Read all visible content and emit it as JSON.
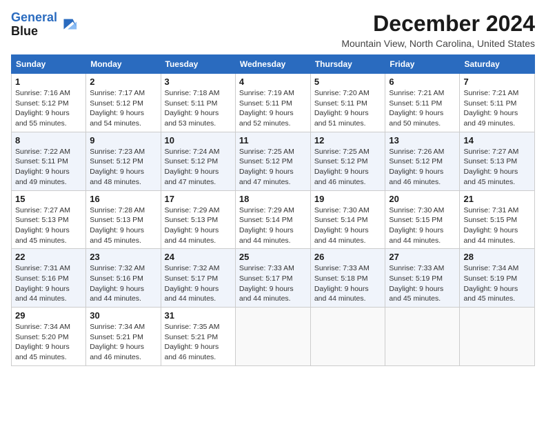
{
  "logo": {
    "line1": "General",
    "line2": "Blue"
  },
  "title": "December 2024",
  "location": "Mountain View, North Carolina, United States",
  "days_of_week": [
    "Sunday",
    "Monday",
    "Tuesday",
    "Wednesday",
    "Thursday",
    "Friday",
    "Saturday"
  ],
  "weeks": [
    [
      {
        "day": "1",
        "sunrise": "7:16 AM",
        "sunset": "5:12 PM",
        "daylight": "9 hours and 55 minutes."
      },
      {
        "day": "2",
        "sunrise": "7:17 AM",
        "sunset": "5:12 PM",
        "daylight": "9 hours and 54 minutes."
      },
      {
        "day": "3",
        "sunrise": "7:18 AM",
        "sunset": "5:11 PM",
        "daylight": "9 hours and 53 minutes."
      },
      {
        "day": "4",
        "sunrise": "7:19 AM",
        "sunset": "5:11 PM",
        "daylight": "9 hours and 52 minutes."
      },
      {
        "day": "5",
        "sunrise": "7:20 AM",
        "sunset": "5:11 PM",
        "daylight": "9 hours and 51 minutes."
      },
      {
        "day": "6",
        "sunrise": "7:21 AM",
        "sunset": "5:11 PM",
        "daylight": "9 hours and 50 minutes."
      },
      {
        "day": "7",
        "sunrise": "7:21 AM",
        "sunset": "5:11 PM",
        "daylight": "9 hours and 49 minutes."
      }
    ],
    [
      {
        "day": "8",
        "sunrise": "7:22 AM",
        "sunset": "5:11 PM",
        "daylight": "9 hours and 49 minutes."
      },
      {
        "day": "9",
        "sunrise": "7:23 AM",
        "sunset": "5:12 PM",
        "daylight": "9 hours and 48 minutes."
      },
      {
        "day": "10",
        "sunrise": "7:24 AM",
        "sunset": "5:12 PM",
        "daylight": "9 hours and 47 minutes."
      },
      {
        "day": "11",
        "sunrise": "7:25 AM",
        "sunset": "5:12 PM",
        "daylight": "9 hours and 47 minutes."
      },
      {
        "day": "12",
        "sunrise": "7:25 AM",
        "sunset": "5:12 PM",
        "daylight": "9 hours and 46 minutes."
      },
      {
        "day": "13",
        "sunrise": "7:26 AM",
        "sunset": "5:12 PM",
        "daylight": "9 hours and 46 minutes."
      },
      {
        "day": "14",
        "sunrise": "7:27 AM",
        "sunset": "5:13 PM",
        "daylight": "9 hours and 45 minutes."
      }
    ],
    [
      {
        "day": "15",
        "sunrise": "7:27 AM",
        "sunset": "5:13 PM",
        "daylight": "9 hours and 45 minutes."
      },
      {
        "day": "16",
        "sunrise": "7:28 AM",
        "sunset": "5:13 PM",
        "daylight": "9 hours and 45 minutes."
      },
      {
        "day": "17",
        "sunrise": "7:29 AM",
        "sunset": "5:13 PM",
        "daylight": "9 hours and 44 minutes."
      },
      {
        "day": "18",
        "sunrise": "7:29 AM",
        "sunset": "5:14 PM",
        "daylight": "9 hours and 44 minutes."
      },
      {
        "day": "19",
        "sunrise": "7:30 AM",
        "sunset": "5:14 PM",
        "daylight": "9 hours and 44 minutes."
      },
      {
        "day": "20",
        "sunrise": "7:30 AM",
        "sunset": "5:15 PM",
        "daylight": "9 hours and 44 minutes."
      },
      {
        "day": "21",
        "sunrise": "7:31 AM",
        "sunset": "5:15 PM",
        "daylight": "9 hours and 44 minutes."
      }
    ],
    [
      {
        "day": "22",
        "sunrise": "7:31 AM",
        "sunset": "5:16 PM",
        "daylight": "9 hours and 44 minutes."
      },
      {
        "day": "23",
        "sunrise": "7:32 AM",
        "sunset": "5:16 PM",
        "daylight": "9 hours and 44 minutes."
      },
      {
        "day": "24",
        "sunrise": "7:32 AM",
        "sunset": "5:17 PM",
        "daylight": "9 hours and 44 minutes."
      },
      {
        "day": "25",
        "sunrise": "7:33 AM",
        "sunset": "5:17 PM",
        "daylight": "9 hours and 44 minutes."
      },
      {
        "day": "26",
        "sunrise": "7:33 AM",
        "sunset": "5:18 PM",
        "daylight": "9 hours and 44 minutes."
      },
      {
        "day": "27",
        "sunrise": "7:33 AM",
        "sunset": "5:19 PM",
        "daylight": "9 hours and 45 minutes."
      },
      {
        "day": "28",
        "sunrise": "7:34 AM",
        "sunset": "5:19 PM",
        "daylight": "9 hours and 45 minutes."
      }
    ],
    [
      {
        "day": "29",
        "sunrise": "7:34 AM",
        "sunset": "5:20 PM",
        "daylight": "9 hours and 45 minutes."
      },
      {
        "day": "30",
        "sunrise": "7:34 AM",
        "sunset": "5:21 PM",
        "daylight": "9 hours and 46 minutes."
      },
      {
        "day": "31",
        "sunrise": "7:35 AM",
        "sunset": "5:21 PM",
        "daylight": "9 hours and 46 minutes."
      },
      null,
      null,
      null,
      null
    ]
  ]
}
